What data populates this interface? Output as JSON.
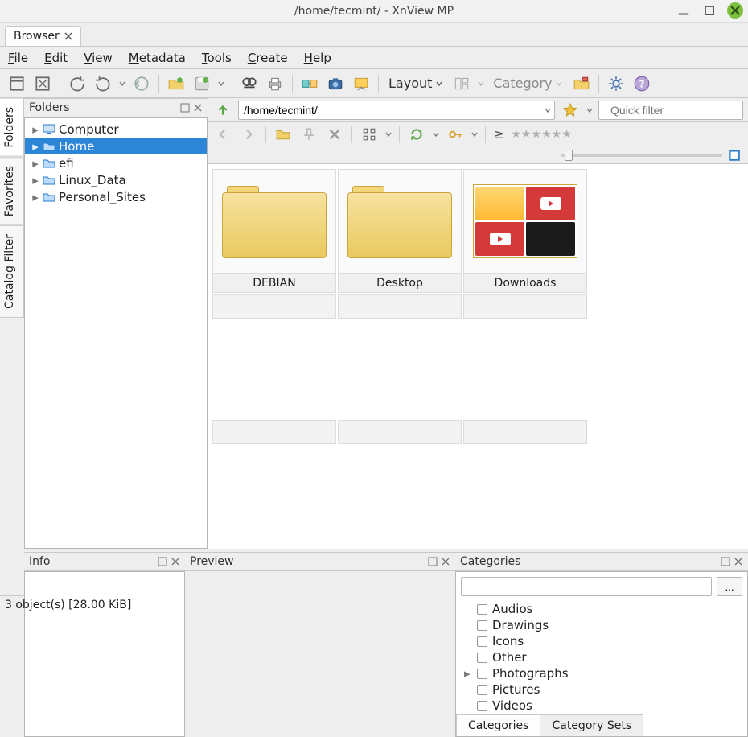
{
  "window": {
    "title": "/home/tecmint/ - XnView MP"
  },
  "tabs": [
    {
      "label": "Browser"
    }
  ],
  "menu": {
    "file": {
      "label": "File",
      "accel": "F"
    },
    "edit": {
      "label": "Edit",
      "accel": "E"
    },
    "view": {
      "label": "View",
      "accel": "V"
    },
    "metadata": {
      "label": "Metadata",
      "accel": "M"
    },
    "tools": {
      "label": "Tools",
      "accel": "T"
    },
    "create": {
      "label": "Create",
      "accel": "C"
    },
    "help": {
      "label": "Help",
      "accel": "H"
    }
  },
  "toolbar": {
    "layout_label": "Layout",
    "category_label": "Category"
  },
  "side_tabs": {
    "folders": "Folders",
    "favorites": "Favorites",
    "catalog": "Catalog Filter"
  },
  "folders_panel": {
    "title": "Folders",
    "items": [
      {
        "label": "Computer",
        "icon": "computer",
        "expandable": true
      },
      {
        "label": "Home",
        "icon": "folder",
        "expandable": true,
        "selected": true
      },
      {
        "label": "efi",
        "icon": "folder",
        "expandable": true
      },
      {
        "label": "Linux_Data",
        "icon": "folder",
        "expandable": true
      },
      {
        "label": "Personal_Sites",
        "icon": "folder",
        "expandable": true
      }
    ]
  },
  "pathbar": {
    "value": "/home/tecmint/",
    "quickfilter_placeholder": "Quick filter"
  },
  "thumbs": [
    {
      "label": "DEBIAN",
      "kind": "folder"
    },
    {
      "label": "Desktop",
      "kind": "folder"
    },
    {
      "label": "Downloads",
      "kind": "folder-preview"
    }
  ],
  "info_panel": {
    "title": "Info"
  },
  "preview_panel": {
    "title": "Preview"
  },
  "categories_panel": {
    "title": "Categories",
    "browse_button": "...",
    "items": [
      {
        "label": "Audios"
      },
      {
        "label": "Drawings"
      },
      {
        "label": "Icons"
      },
      {
        "label": "Other"
      },
      {
        "label": "Photographs",
        "expandable": true
      },
      {
        "label": "Pictures"
      },
      {
        "label": "Videos"
      }
    ],
    "tabs": {
      "active": "Categories",
      "other": "Category Sets"
    }
  },
  "status": "3 object(s) [28.00 KiB]"
}
